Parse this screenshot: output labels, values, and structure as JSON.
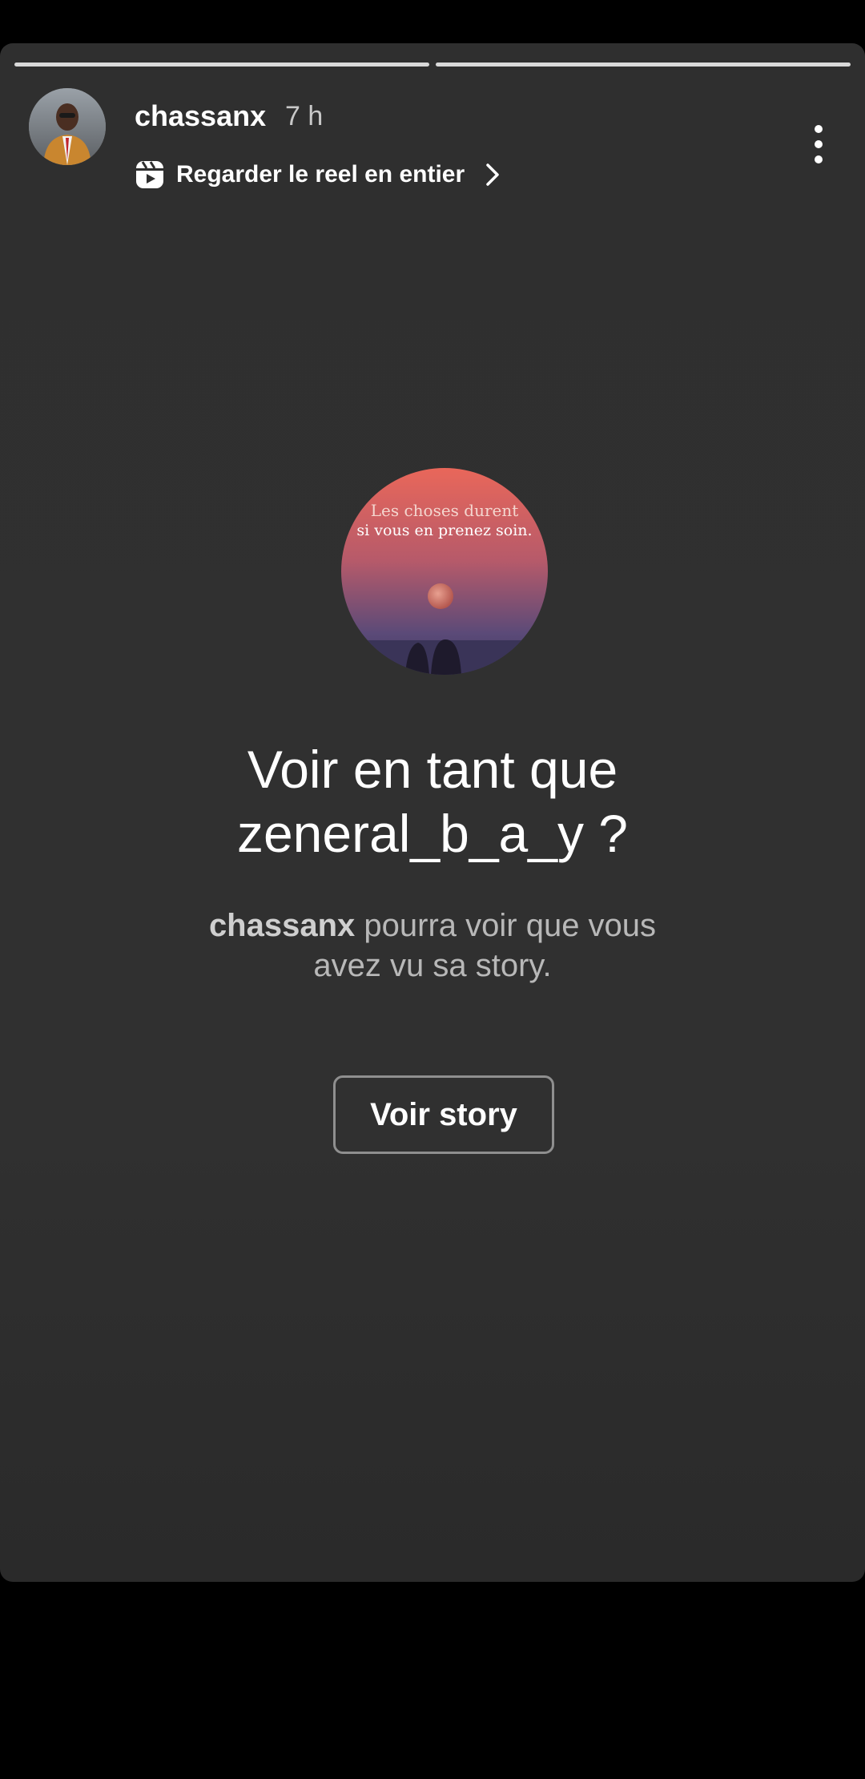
{
  "story": {
    "progress_segments": [
      1,
      1
    ],
    "user": {
      "username": "chassanx",
      "time_ago": "7 h"
    },
    "reel_link_label": "Regarder le reel en entier",
    "preview": {
      "line1": "Les choses durent",
      "line2": "si vous en prenez soin."
    },
    "question_line1": "Voir en tant que",
    "question_line2": "zeneral_b_a_y ?",
    "subtext_username": "chassanx",
    "subtext_line1_rest": " pourra voir que vous",
    "subtext_line2": "avez vu sa story.",
    "view_button_label": "Voir story"
  },
  "colors": {
    "card_background": "#2f2f2f",
    "page_background": "#000000",
    "text_primary": "#ffffff",
    "text_secondary": "#b8b8b8",
    "button_border": "#8f8f8f"
  },
  "icons": {
    "reel": "reels-icon",
    "chevron": "chevron-right-icon",
    "more": "more-vertical-icon"
  }
}
